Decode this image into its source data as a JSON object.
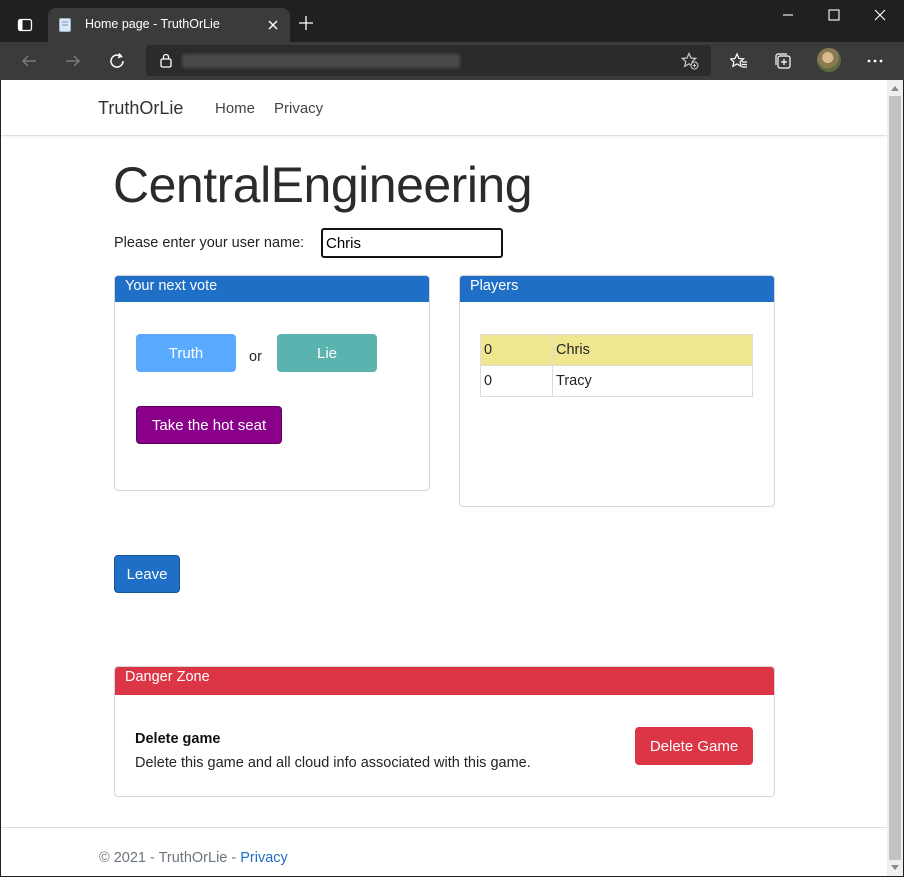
{
  "browser": {
    "tab_title": "Home page - TruthOrLie",
    "icons": [
      "tab-actions-icon",
      "page-icon",
      "close-icon",
      "plus-icon",
      "minimize-icon",
      "maximize-icon",
      "close-window-icon",
      "back-arrow-icon",
      "forward-arrow-icon",
      "refresh-icon",
      "lock-icon",
      "add-favorite-icon",
      "favorites-icon",
      "collections-icon",
      "profile-avatar",
      "more-icon"
    ]
  },
  "navbar": {
    "brand": "TruthOrLie",
    "links": [
      {
        "label": "Home"
      },
      {
        "label": "Privacy"
      }
    ]
  },
  "main": {
    "title": "CentralEngineering",
    "username_label": "Please enter your user name:",
    "username_value": "Chris",
    "vote_card": {
      "header": "Your next vote",
      "truth_label": "Truth",
      "or_label": "or",
      "lie_label": "Lie",
      "hot_seat_label": "Take the hot seat",
      "colors": {
        "truth": "#5aabff",
        "lie": "#5bb3b0",
        "hot_seat": "#8b008b"
      }
    },
    "players_card": {
      "header": "Players",
      "rows": [
        {
          "score": "0",
          "name": "Chris",
          "highlighted": true
        },
        {
          "score": "0",
          "name": "Tracy",
          "highlighted": false
        }
      ]
    },
    "leave_label": "Leave",
    "danger_zone": {
      "header": "Danger Zone",
      "title": "Delete game",
      "description": "Delete this game and all cloud info associated with this game.",
      "button_label": "Delete Game"
    }
  },
  "footer": {
    "text": "© 2021 - TruthOrLie - ",
    "link": "Privacy"
  },
  "colors": {
    "primary": "#1e6fc5",
    "danger": "#dc3545",
    "highlight": "#efe68f"
  }
}
